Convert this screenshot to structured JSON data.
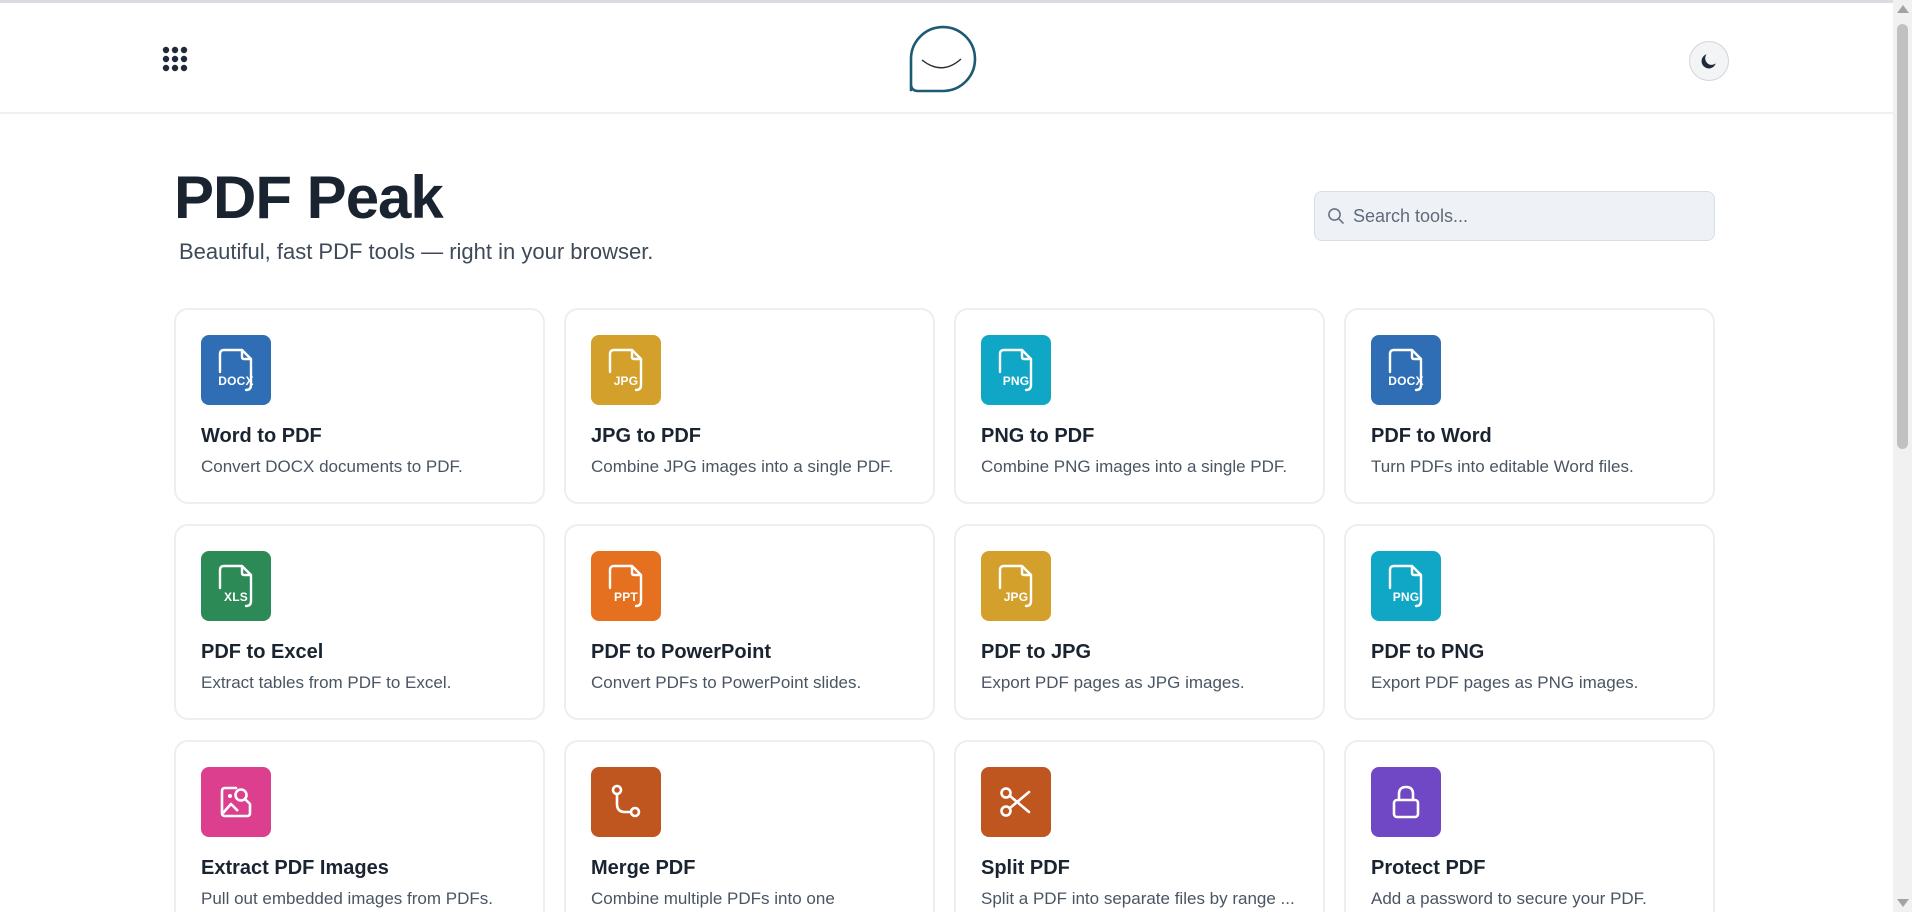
{
  "header": {
    "apps_menu_icon": "grid-dots-icon",
    "logo_icon": "speech-bubble-smile-logo",
    "theme_toggle_icon": "moon-icon"
  },
  "hero": {
    "title": "PDF Peak",
    "subtitle": "Beautiful, fast PDF tools — right in your browser."
  },
  "search": {
    "placeholder": "Search tools...",
    "value": "",
    "icon": "search-icon"
  },
  "tools": [
    {
      "title": "Word to PDF",
      "desc": "Convert DOCX documents to PDF.",
      "icon": "file-icon",
      "badge": "DOCX",
      "color": "#2f6db5"
    },
    {
      "title": "JPG to PDF",
      "desc": "Combine JPG images into a single PDF.",
      "icon": "file-icon",
      "badge": "JPG",
      "color": "#d4a02c"
    },
    {
      "title": "PNG to PDF",
      "desc": "Combine PNG images into a single PDF.",
      "icon": "file-icon",
      "badge": "PNG",
      "color": "#10a6c6"
    },
    {
      "title": "PDF to Word",
      "desc": "Turn PDFs into editable Word files.",
      "icon": "file-icon",
      "badge": "DOCX",
      "color": "#2f6db5"
    },
    {
      "title": "PDF to Excel",
      "desc": "Extract tables from PDF to Excel.",
      "icon": "file-icon",
      "badge": "XLS",
      "color": "#2c8a57"
    },
    {
      "title": "PDF to PowerPoint",
      "desc": "Convert PDFs to PowerPoint slides.",
      "icon": "file-icon",
      "badge": "PPT",
      "color": "#e5701f"
    },
    {
      "title": "PDF to JPG",
      "desc": "Export PDF pages as JPG images.",
      "icon": "file-icon",
      "badge": "JPG",
      "color": "#d4a02c"
    },
    {
      "title": "PDF to PNG",
      "desc": "Export PDF pages as PNG images.",
      "icon": "file-icon",
      "badge": "PNG",
      "color": "#10a6c6"
    },
    {
      "title": "Extract PDF Images",
      "desc": "Pull out embedded images from PDFs.",
      "icon": "image-search-icon",
      "badge": "",
      "color": "#dc3f8e"
    },
    {
      "title": "Merge PDF",
      "desc": "Combine multiple PDFs into one",
      "icon": "merge-icon",
      "badge": "",
      "color": "#c0561f"
    },
    {
      "title": "Split PDF",
      "desc": "Split a PDF into separate files by range ...",
      "icon": "scissors-icon",
      "badge": "",
      "color": "#c0561f"
    },
    {
      "title": "Protect PDF",
      "desc": "Add a password to secure your PDF.",
      "icon": "lock-icon",
      "badge": "",
      "color": "#7047c4"
    }
  ]
}
